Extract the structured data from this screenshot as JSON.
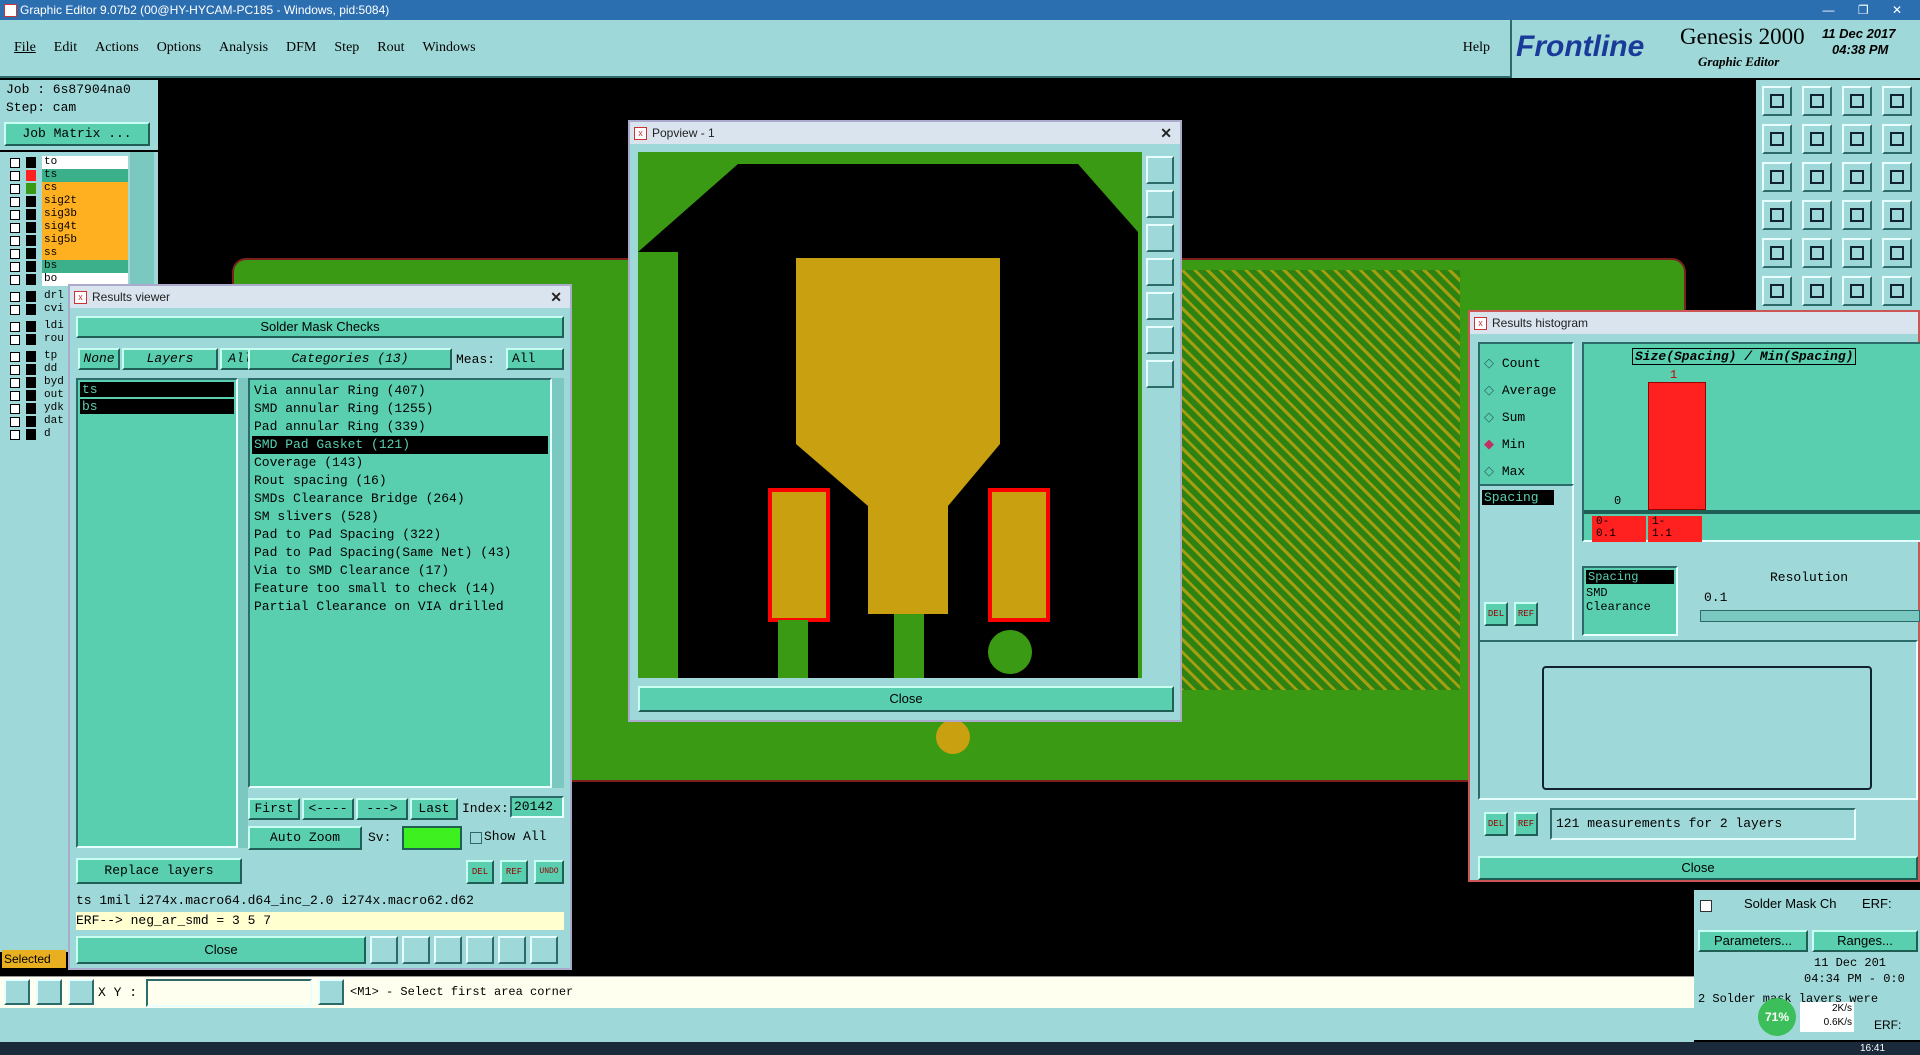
{
  "title_bar": "Graphic Editor 9.07b2 (00@HY-HYCAM-PC185 - Windows, pid:5084)",
  "menu": [
    "File",
    "Edit",
    "Actions",
    "Options",
    "Analysis",
    "DFM",
    "Step",
    "Rout",
    "Windows"
  ],
  "help": "Help",
  "brand": {
    "logo": "Frontline",
    "product": "Genesis 2000",
    "subtitle": "Graphic Editor",
    "date": "11 Dec 2017",
    "time": "04:38 PM"
  },
  "job": {
    "job": "Job : 6s87904na0",
    "step": "Step: cam",
    "matrix_button": "Job Matrix ..."
  },
  "layers": [
    "to",
    "ts",
    "cs",
    "sig2t",
    "sig3b",
    "sig4t",
    "sig5b",
    "ss",
    "bs",
    "bo",
    "drl",
    "cvi",
    "ldi",
    "rou",
    "tp",
    "dd",
    "byd",
    "out",
    "ydk",
    "dat",
    "d"
  ],
  "selected_label": "Selected",
  "results_viewer": {
    "title": "Results viewer",
    "header": "Solder Mask Checks",
    "none": "None",
    "layers": "Layers",
    "all": "All",
    "categories": "Categories (13)",
    "meas": "Meas:",
    "meas_value": "All",
    "layer_list": [
      "ts",
      "bs"
    ],
    "category_list": [
      "Via annular Ring (407)",
      "SMD annular Ring (1255)",
      "Pad annular Ring (339)",
      "SMD Pad Gasket (121)",
      "Coverage (143)",
      "Rout spacing (16)",
      "SMDs Clearance Bridge (264)",
      "SM slivers (528)",
      "Pad to Pad Spacing (322)",
      "Pad to Pad Spacing(Same Net) (43)",
      "Via to SMD Clearance (17)",
      "Feature too small to check (14)",
      "Partial Clearance on VIA drilled"
    ],
    "first": "First",
    "prev": "<----",
    "next": "--->",
    "last": "Last",
    "index_label": "Index:",
    "index_value": "20142",
    "auto_zoom": "Auto Zoom",
    "sv": "Sv:",
    "show_all": "Show All",
    "replace_layers": "Replace layers",
    "info_line": "ts 1mil  i274x.macro64.d64_inc_2.0  i274x.macro62.d62",
    "erf_line": "ERF--> neg_ar_smd = 3 5 7",
    "close": "Close",
    "del": "DEL",
    "ref": "REF",
    "undo": "UNDO"
  },
  "popview": {
    "title": "Popview - 1",
    "close": "Close"
  },
  "histogram": {
    "title": "Results histogram",
    "options": [
      "Count",
      "Average",
      "Sum",
      "Min",
      "Max"
    ],
    "chart_title": "Size(Spacing) / Min(Spacing)",
    "bar_top_label": "1",
    "zero_label": "0",
    "bins": [
      "0-\n0.1",
      "1-\n1.1"
    ],
    "measure_list": [
      "Spacing"
    ],
    "type_list": [
      "Spacing",
      "SMD",
      "Clearance"
    ],
    "resolution_label": "Resolution",
    "resolution_value": "0.1",
    "summary": "121 measurements for 2 layers",
    "close": "Close",
    "del": "DEL",
    "ref": "REF"
  },
  "side_panel": {
    "check_title": "Solder Mask Ch",
    "erf": "ERF:",
    "parameters": "Parameters...",
    "ranges": "Ranges...",
    "date": "11 Dec 201",
    "time": "04:34 PM - 0:0",
    "note": "2 Solder mask layers were",
    "erf2": "ERF:"
  },
  "bottom": {
    "xy": "X Y :",
    "status": "<M1> - Select first area corner"
  },
  "tray": {
    "pct": "71%",
    "up": "2K/s",
    "down": "0.6K/s",
    "clock": "16:41"
  },
  "colors": {
    "teal": "#9fd8d8",
    "panel": "#59cfb0",
    "pcb": "#3a9a14",
    "copper": "#c8a010",
    "highlight": "#ff0000",
    "layer_active": "#ffb020"
  }
}
